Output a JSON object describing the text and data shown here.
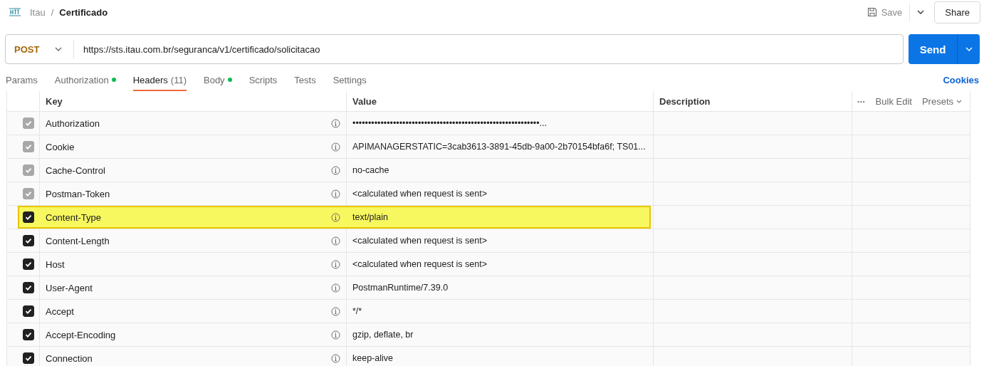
{
  "breadcrumb": {
    "parent": "Itau",
    "separator": "/",
    "current": "Certificado"
  },
  "toolbar": {
    "save": "Save",
    "share": "Share"
  },
  "request": {
    "method": "POST",
    "url": "https://sts.itau.com.br/seguranca/v1/certificado/solicitacao",
    "send": "Send"
  },
  "tabs": [
    {
      "label": "Params",
      "selected": false,
      "dot": false
    },
    {
      "label": "Authorization",
      "selected": false,
      "dot": true
    },
    {
      "label": "Headers",
      "count": "(11)",
      "selected": true,
      "dot": false
    },
    {
      "label": "Body",
      "selected": false,
      "dot": true
    },
    {
      "label": "Scripts",
      "selected": false,
      "dot": false
    },
    {
      "label": "Tests",
      "selected": false,
      "dot": false
    },
    {
      "label": "Settings",
      "selected": false,
      "dot": false
    }
  ],
  "cookies_link": "Cookies",
  "table": {
    "columns": [
      "Key",
      "Value",
      "Description"
    ],
    "actions": {
      "more": "•••",
      "bulk_edit": "Bulk Edit",
      "presets": "Presets"
    },
    "rows": [
      {
        "key": "Authorization",
        "value": "••••••••••••••••••••••••••••••••••••••••••••••••••••••••••••...",
        "checked": true,
        "disabled": true,
        "highlighted": false
      },
      {
        "key": "Cookie",
        "value": "APIMANAGERSTATIC=3cab3613-3891-45db-9a00-2b70154bfa6f; TS01...",
        "checked": true,
        "disabled": true,
        "highlighted": false
      },
      {
        "key": "Cache-Control",
        "value": "no-cache",
        "checked": true,
        "disabled": true,
        "highlighted": false
      },
      {
        "key": "Postman-Token",
        "value": "<calculated when request is sent>",
        "checked": true,
        "disabled": true,
        "highlighted": false
      },
      {
        "key": "Content-Type",
        "value": "text/plain",
        "checked": true,
        "disabled": false,
        "highlighted": true
      },
      {
        "key": "Content-Length",
        "value": "<calculated when request is sent>",
        "checked": true,
        "disabled": false,
        "highlighted": false
      },
      {
        "key": "Host",
        "value": "<calculated when request is sent>",
        "checked": true,
        "disabled": false,
        "highlighted": false
      },
      {
        "key": "User-Agent",
        "value": "PostmanRuntime/7.39.0",
        "checked": true,
        "disabled": false,
        "highlighted": false
      },
      {
        "key": "Accept",
        "value": "*/*",
        "checked": true,
        "disabled": false,
        "highlighted": false
      },
      {
        "key": "Accept-Encoding",
        "value": "gzip, deflate, br",
        "checked": true,
        "disabled": false,
        "highlighted": false
      },
      {
        "key": "Connection",
        "value": "keep-alive",
        "checked": true,
        "disabled": false,
        "highlighted": false
      }
    ]
  }
}
